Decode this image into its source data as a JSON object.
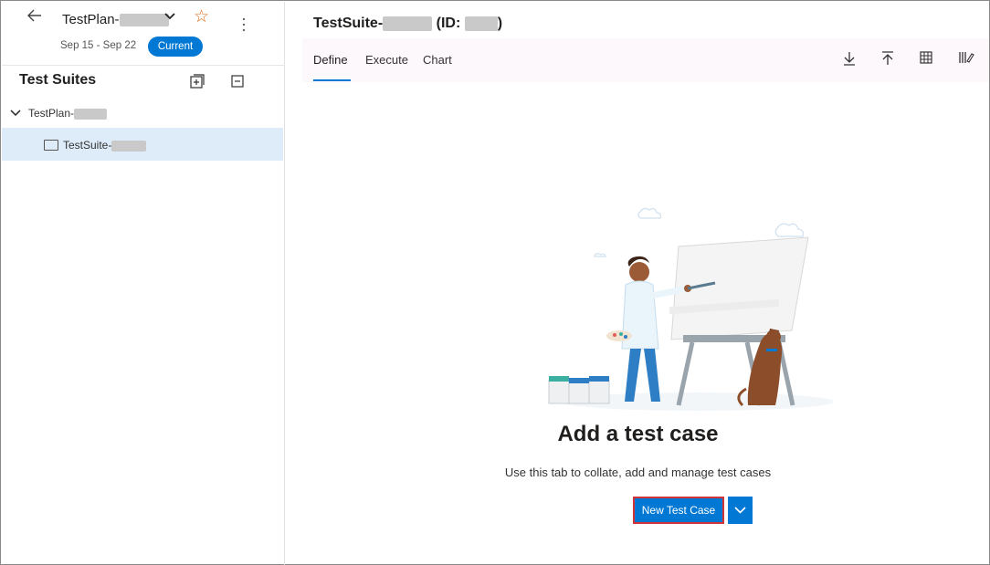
{
  "plan": {
    "name_prefix": "TestPlan-",
    "dates": "Sep 15 - Sep 22",
    "badge": "Current"
  },
  "sidebar": {
    "title": "Test Suites",
    "tree": [
      {
        "label": "TestPlan-",
        "expanded": true
      },
      {
        "label": "TestSuite-",
        "selected": true
      }
    ]
  },
  "main": {
    "title_prefix": "TestSuite-",
    "id_prefix": "(ID: ",
    "id_suffix": ")",
    "tabs": [
      {
        "label": "Define",
        "active": true
      },
      {
        "label": "Execute"
      },
      {
        "label": "Chart"
      }
    ],
    "toolbar_icons": [
      "download-icon",
      "upload-icon",
      "grid-icon",
      "column-options-icon"
    ],
    "empty_state": {
      "title": "Add a test case",
      "subtitle": "Use this tab to collate, add and manage test cases",
      "button_label": "New Test Case"
    }
  },
  "colors": {
    "accent": "#0078d4",
    "star": "#d86a1a",
    "highlight_border": "#d13438",
    "selected_row": "#deecf9"
  }
}
